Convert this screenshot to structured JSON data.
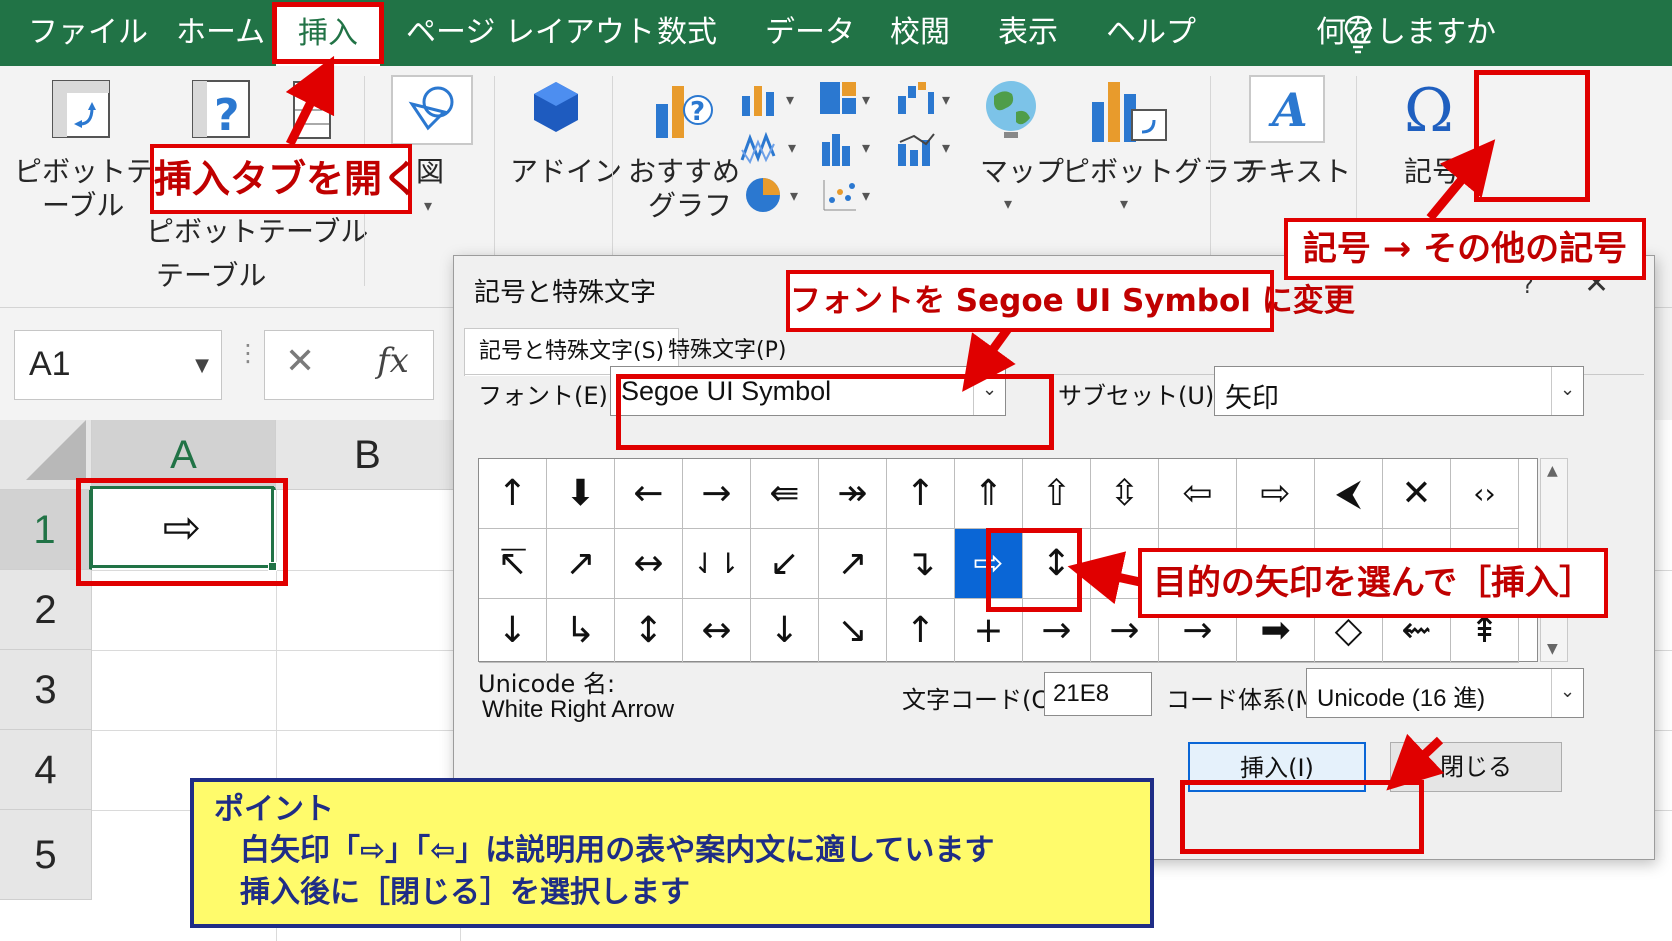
{
  "ribbon_tabs": [
    {
      "label": "ファイル"
    },
    {
      "label": "ホーム"
    },
    {
      "label": "挿入"
    },
    {
      "label": "ページ レイアウト"
    },
    {
      "label": "数式"
    },
    {
      "label": "データ"
    },
    {
      "label": "校閲"
    },
    {
      "label": "表示"
    },
    {
      "label": "ヘルプ"
    }
  ],
  "active_tab": "挿入",
  "tell_me": "何をしますか",
  "ribbon": {
    "pivot_table": [
      "ピボットテー",
      "ーブル"
    ],
    "recommended_pivot": "ピボットテーブル",
    "group_table": "テーブル",
    "illustrations": "図",
    "addins": "アドイン",
    "recommended_charts": [
      "おすすめ",
      "グラフ"
    ],
    "maps": "マップ",
    "pivot_chart": "ピボットグラフ",
    "text": "テキスト",
    "symbols": "記号"
  },
  "formula_bar": {
    "name_box": "A1",
    "cancel": "✕",
    "fx": "fx"
  },
  "grid": {
    "columns": [
      "A",
      "B"
    ],
    "rows": [
      "1",
      "2",
      "3",
      "4",
      "5"
    ],
    "cell_a1": "⇨"
  },
  "dialog": {
    "title": "記号と特殊文字",
    "help": "?",
    "close": "✕",
    "tabs": [
      "記号と特殊文字(S)",
      "特殊文字(P)"
    ],
    "font_label": "フォント(E):",
    "font_value": "Segoe UI Symbol",
    "subset_label": "サブセット(U):",
    "subset_value": "矢印",
    "symbols": [
      [
        "↑",
        "⬇",
        "←",
        "→",
        "⇚",
        "↠",
        "↑",
        "⇑",
        "⇧",
        "⇳",
        "⇦",
        "⇨",
        "⮜",
        "✕",
        "‹›"
      ],
      [
        "↸",
        "↗",
        "↔",
        "⇃⇂",
        "↙",
        "↗",
        "↴",
        "⇨",
        "↕",
        "",
        "",
        "",
        "",
        "",
        ""
      ],
      [
        "↓",
        "↳",
        "↕",
        "↔",
        "↓",
        "↘",
        "↑",
        "+",
        "→",
        "→",
        "→",
        "➡",
        "◇",
        "⇜",
        "⇞"
      ]
    ],
    "unicode_name_label": "Unicode 名:",
    "unicode_name_value": "White Right Arrow",
    "char_code_label": "文字コード(C):",
    "char_code_value": "21E8",
    "code_system_label": "コード体系(M):",
    "code_system_value": "Unicode (16 進)",
    "insert_button": "挿入(I)",
    "close_button": "閉じる"
  },
  "callouts": {
    "open_insert_tab": "挿入タブを開く",
    "symbol_path": "記号 → その他の記号",
    "change_font": "フォントを Segoe UI Symbol に変更",
    "select_and_insert": "目的の矢印を選んで［挿入］"
  },
  "point": {
    "title": "ポイント",
    "lines": [
      "白矢印「⇨」「⇦」は説明用の表や案内文に適しています",
      "挿入後に［閉じる］を選択します"
    ]
  },
  "colors": {
    "excel_green": "#217346",
    "callout_red": "#e00000",
    "selection_blue": "#0a66d6",
    "point_yellow": "#fffb6b",
    "point_navy": "#1f2d86"
  }
}
